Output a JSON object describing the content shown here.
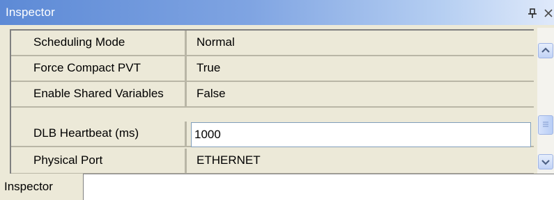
{
  "window": {
    "title": "Inspector",
    "pin_icon": "pin-icon",
    "close_icon": "close-icon"
  },
  "properties": [
    {
      "name": "Scheduling Mode",
      "value": "Normal"
    },
    {
      "name": "Force Compact PVT",
      "value": "True"
    },
    {
      "name": "Enable Shared Variables",
      "value": "False"
    },
    {
      "name": "DLB Heartbeat (ms)",
      "value": "1000",
      "editing": true
    },
    {
      "name": "Physical Port",
      "value": "ETHERNET"
    }
  ],
  "scrollbar": {
    "up_icon": "chevron-up-icon",
    "down_icon": "chevron-down-icon"
  },
  "tabs": [
    {
      "label": "Inspector",
      "active": true
    }
  ],
  "colors": {
    "titlebar_start": "#5d8ad6",
    "titlebar_end": "#dfe9fa",
    "panel_bg": "#ece9d8",
    "grid_line": "#b9b6a6",
    "scrollbar_accent": "#4d6185"
  }
}
